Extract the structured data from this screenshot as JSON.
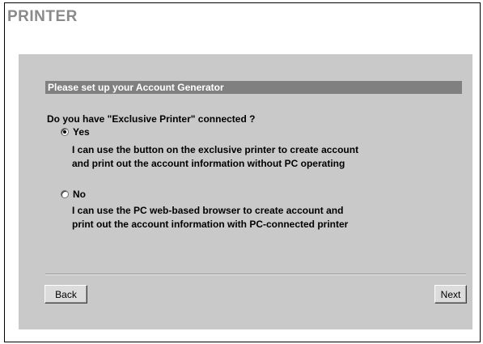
{
  "page": {
    "title": "PRINTER"
  },
  "panel": {
    "section_title": "Please set up your Account Generator",
    "question": "Do you have \"Exclusive Printer\" connected ?",
    "options": [
      {
        "label": "Yes",
        "selected": true,
        "description_lines": [
          "I can use the button on the exclusive printer to create account",
          "and print out the account information without PC operating"
        ]
      },
      {
        "label": "No",
        "selected": false,
        "description_lines": [
          "I can use the PC web-based browser to create account and",
          "print out the account information with PC-connected printer"
        ]
      }
    ]
  },
  "buttons": {
    "back": "Back",
    "next": "Next"
  },
  "colors": {
    "title": "#8a8a8a",
    "panel_background": "#c9c9c9",
    "section_bar": "#808080",
    "section_text": "#ffffff"
  }
}
